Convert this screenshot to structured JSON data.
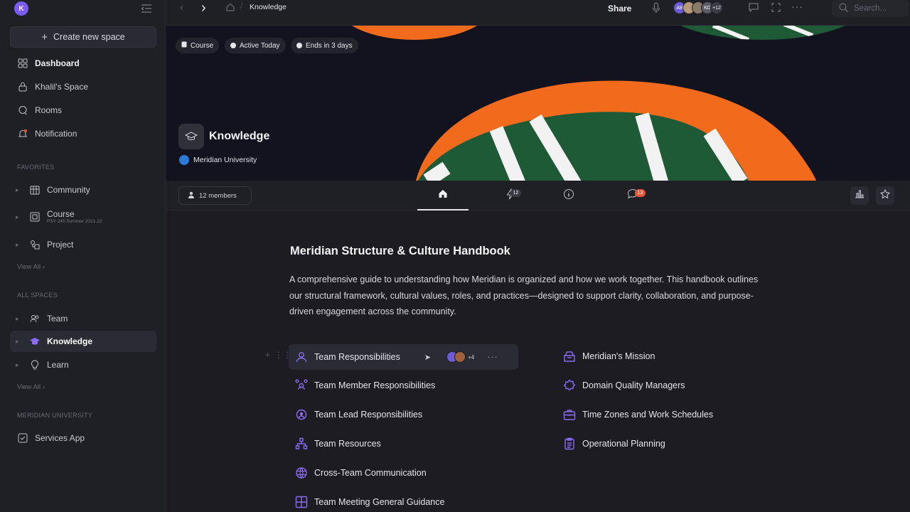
{
  "sidebar": {
    "workspace_initial": "K",
    "create_label": "Create new space",
    "main_items": [
      {
        "label": "Dashboard"
      },
      {
        "label": "Khalil's Space"
      },
      {
        "label": "Rooms"
      },
      {
        "label": "Notification"
      }
    ],
    "favorites_label": "Favorites",
    "favorites": [
      {
        "label": "Community",
        "sub": ""
      },
      {
        "label": "Course",
        "sub": "PSY 245 Summer 2021-22"
      },
      {
        "label": "Project",
        "sub": ""
      }
    ],
    "view_all_label": "View All",
    "all_spaces_label": "All Spaces",
    "spaces": [
      {
        "label": "Team"
      },
      {
        "label": "Knowledge"
      },
      {
        "label": "Learn"
      }
    ],
    "org_section_label": "Meridian University",
    "org_items": [
      {
        "label": "Services App"
      }
    ]
  },
  "topbar": {
    "breadcrumb": "Knowledge",
    "share_label": "Share",
    "avatars": [
      "AB",
      "",
      "",
      "KD"
    ],
    "more_count": "+12",
    "search_placeholder": "Search..."
  },
  "banner": {
    "tags": [
      "Course",
      "Active Today",
      "Ends in 3 days"
    ],
    "title": "Knowledge",
    "org": "Meridian University",
    "colors": {
      "background": "#12131f",
      "orange": "#f26b1d",
      "green": "#1f5a36",
      "stripe": "#f2f2f2"
    }
  },
  "tabbar": {
    "members_label": "12 members",
    "updates_badge": "12",
    "chat_badge": "13"
  },
  "main": {
    "title": "Meridian Structure & Culture Handbook",
    "description": "A comprehensive guide to understanding how Meridian is organized and how we work together. This handbook outlines our structural framework, cultural values, roles, and practices—designed to support clarity, collaboration, and purpose-driven engagement across the community.",
    "left_links": [
      {
        "label": "Team Responsibilities",
        "icon": "users-icon"
      },
      {
        "label": "Team Member Responsibilities",
        "icon": "team-member-icon"
      },
      {
        "label": "Team Lead Responsibilities",
        "icon": "team-lead-icon"
      },
      {
        "label": "Team Resources",
        "icon": "hierarchy-icon"
      },
      {
        "label": "Cross-Team Communication",
        "icon": "globe-icon"
      },
      {
        "label": "Team Meeting General Guidance",
        "icon": "grid-icon"
      }
    ],
    "right_links": [
      {
        "label": "Meridian's Mission",
        "icon": "inbox-icon"
      },
      {
        "label": "Domain Quality Managers",
        "icon": "badge-icon"
      },
      {
        "label": "Time Zones and Work Schedules",
        "icon": "briefcase-icon"
      },
      {
        "label": "Operational Planning",
        "icon": "clipboard-icon"
      }
    ],
    "row_more_count": "+4",
    "accent": "#8a6cf5"
  }
}
